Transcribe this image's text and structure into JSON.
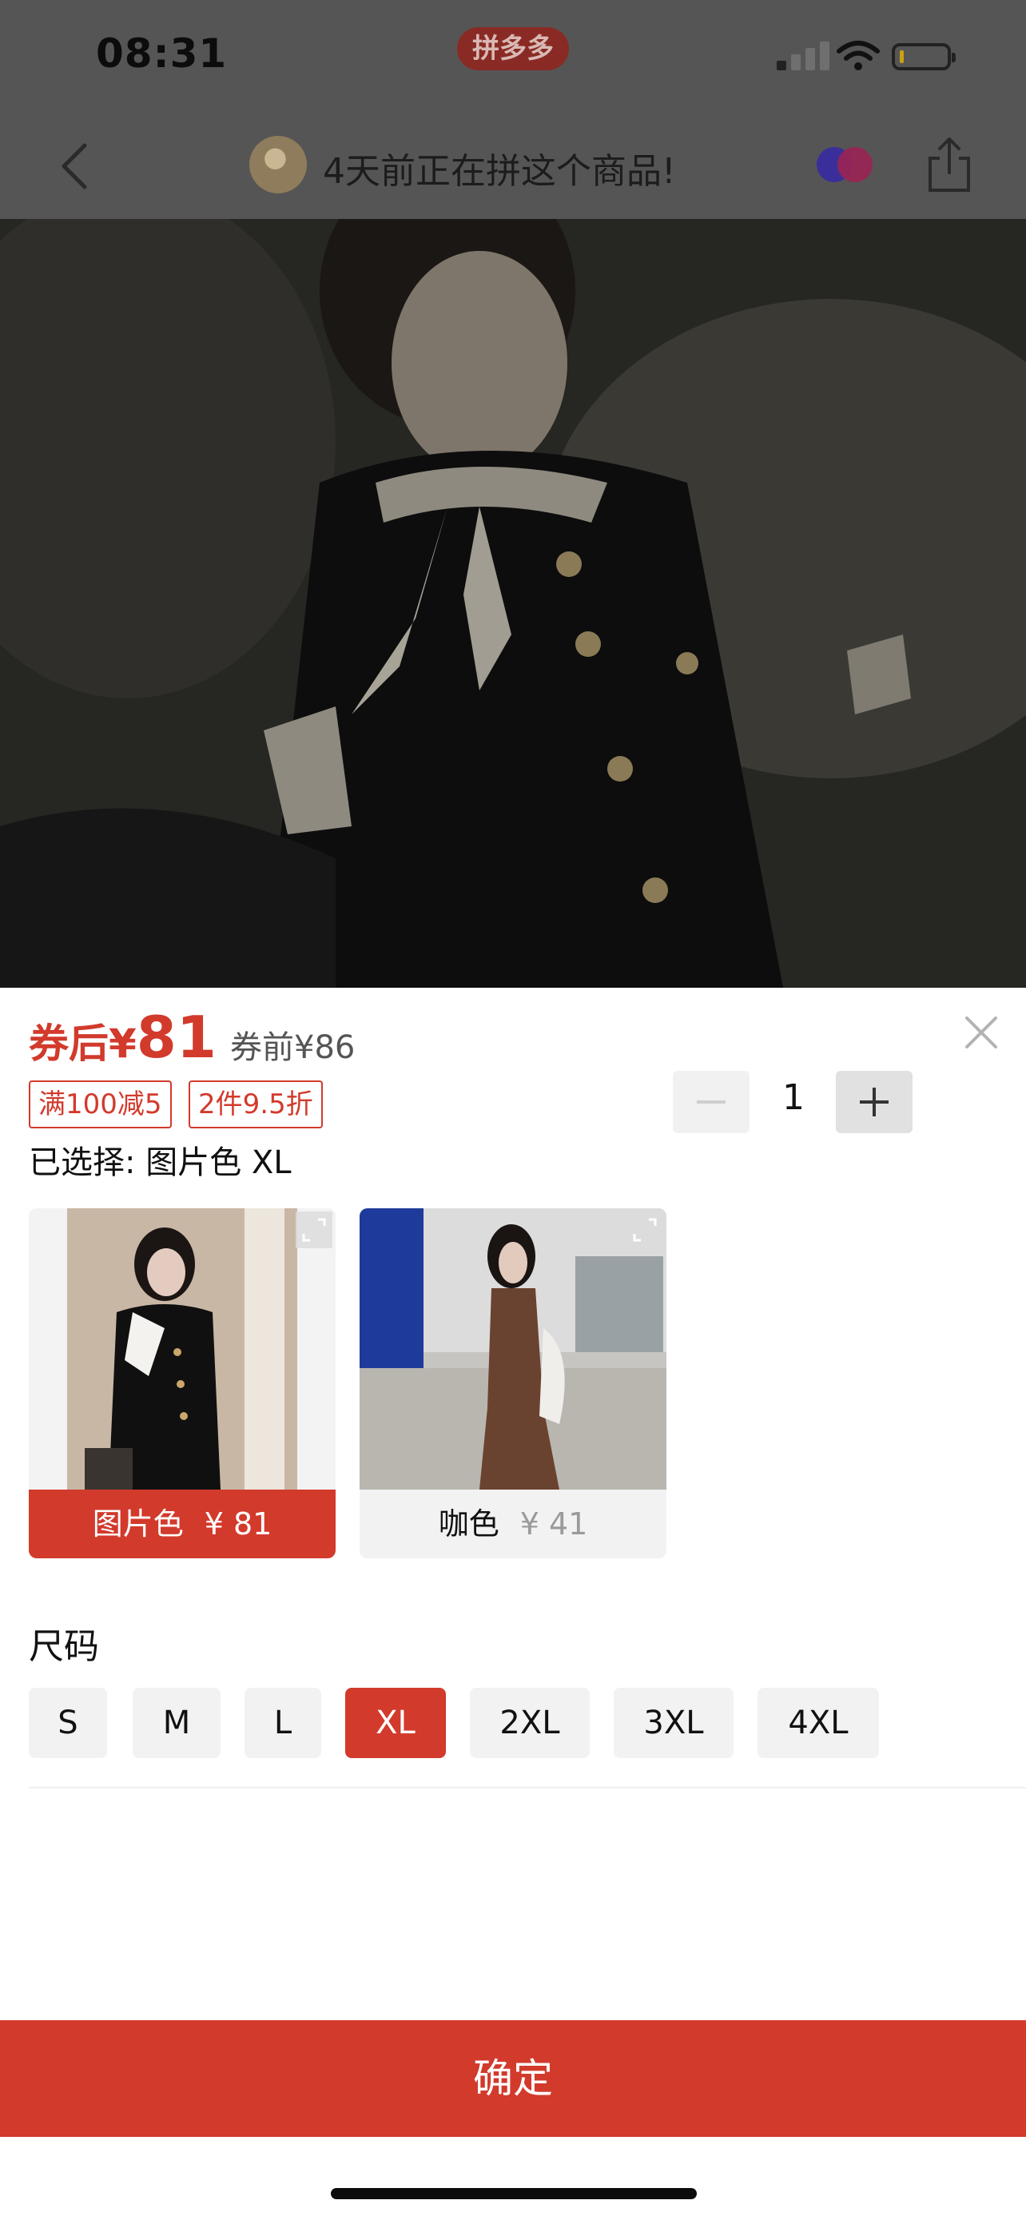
{
  "status_bar": {
    "time": "08:31",
    "app_badge": "拼多多",
    "icons": [
      "signal-icon",
      "wifi-icon",
      "battery-icon"
    ]
  },
  "nav": {
    "title": "4天前正在拼这个商品!",
    "icons": [
      "back-icon",
      "avatar",
      "share-badge-icon",
      "share-icon"
    ]
  },
  "product": {
    "price_prefix": "券后",
    "currency": "¥",
    "price": "81",
    "price_before": "券前¥86",
    "promos": [
      "满100减5",
      "2件9.5折"
    ],
    "quantity": {
      "minus": "−",
      "value": "1",
      "plus": "+"
    },
    "selected": "已选择: 图片色 XL"
  },
  "variants": [
    {
      "name": "图片色",
      "price": "¥ 81",
      "selected": true
    },
    {
      "name": "咖色",
      "price": "¥ 41",
      "selected": false
    }
  ],
  "sizes": {
    "heading": "尺码",
    "options": [
      "S",
      "M",
      "L",
      "XL",
      "2XL",
      "3XL",
      "4XL"
    ],
    "selected": "XL"
  },
  "confirm_label": "确定",
  "colors": {
    "accent": "#d23a2c",
    "chip_bg": "#f2f2f2",
    "overlay": "#555555"
  }
}
